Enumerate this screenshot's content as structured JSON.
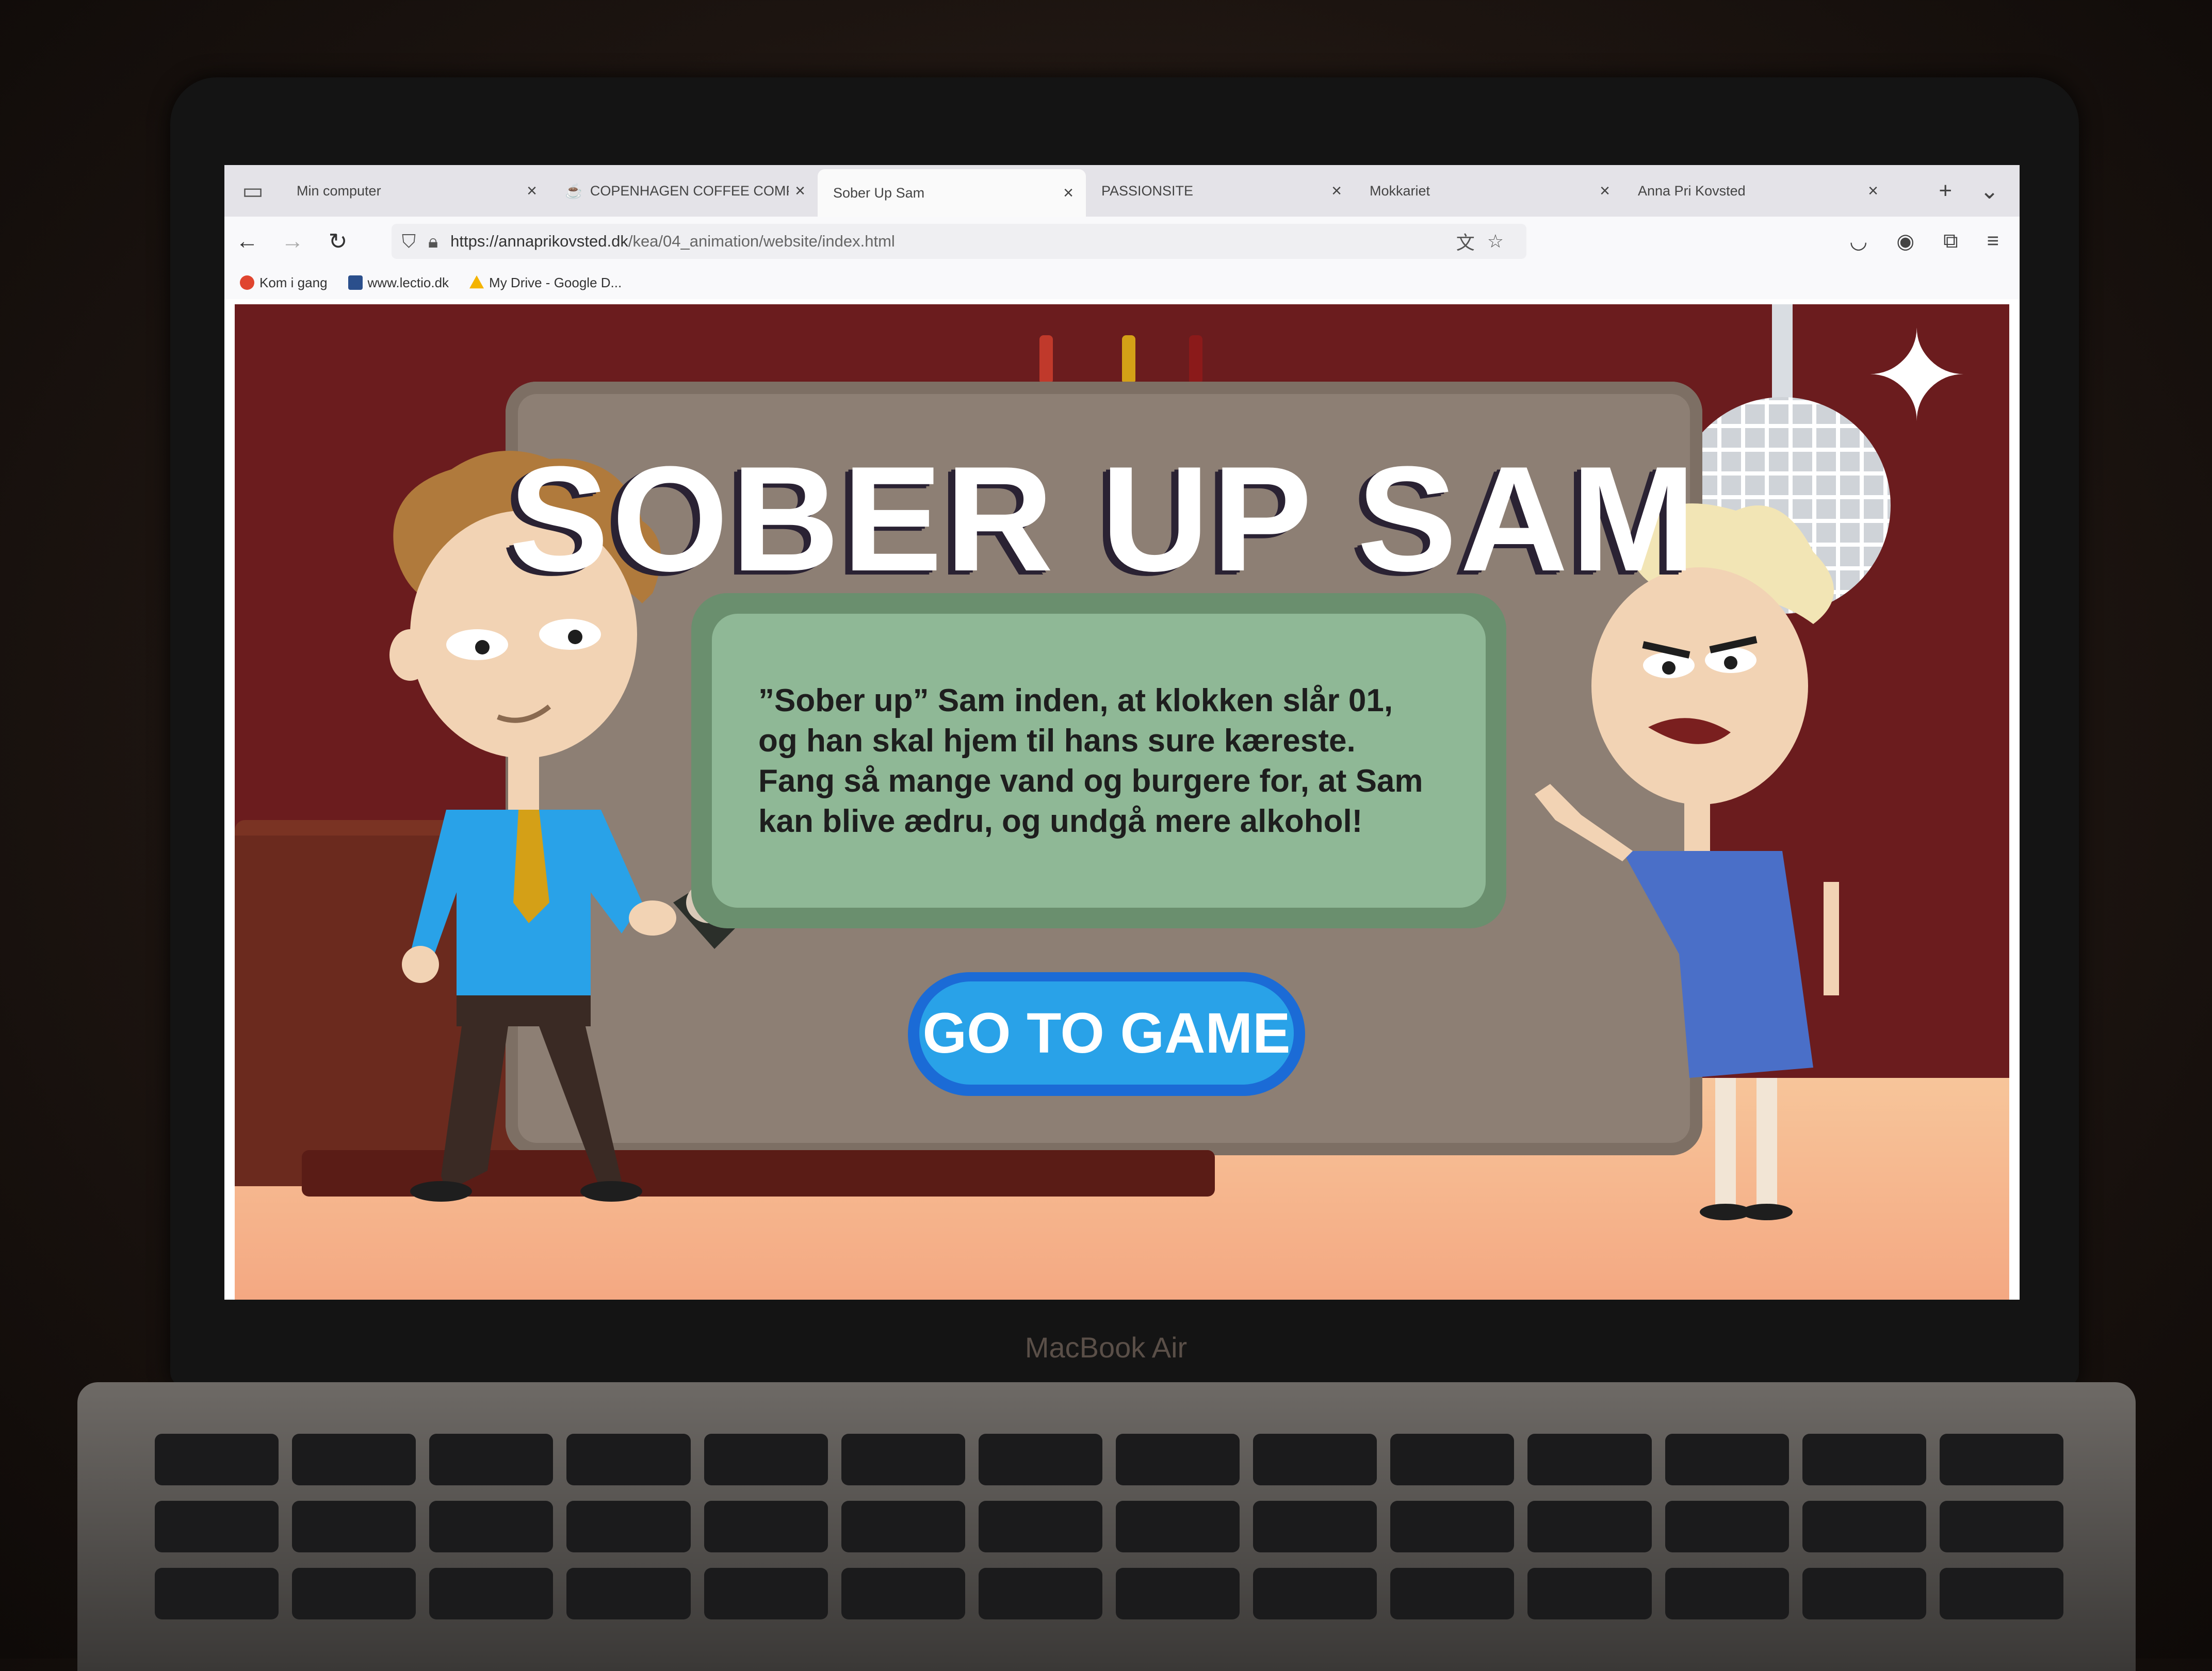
{
  "browser": {
    "tabs": [
      {
        "label": "Min computer",
        "active": false
      },
      {
        "label": "COPENHAGEN COFFEE COMPANY",
        "active": false
      },
      {
        "label": "Sober Up Sam",
        "active": true
      },
      {
        "label": "PASSIONSITE",
        "active": false
      },
      {
        "label": "Mokkariet",
        "active": false
      },
      {
        "label": "Anna Pri Kovsted",
        "active": false
      }
    ],
    "url_host": "https://annaprikovsted.dk",
    "url_path": "/kea/04_animation/website/index.html",
    "bookmarks": [
      {
        "label": "Kom i gang",
        "color": "#e0452f"
      },
      {
        "label": "www.lectio.dk",
        "color": "#2b4f8c"
      },
      {
        "label": "My Drive - Google D...",
        "color": "#f4b400"
      }
    ]
  },
  "game": {
    "title": "SOBER UP SAM",
    "description": "”Sober up” Sam inden, at klokken slår 01, og han skal hjem til hans sure kæreste. Fang så mange vand og burgere for, at Sam kan blive ædru, og undgå mere alkohol!",
    "button_label": "GO TO GAME"
  },
  "device": {
    "brand_label": "MacBook Air"
  },
  "icons": [
    "sidebar-icon",
    "close-icon",
    "new-tab-icon",
    "tab-list-icon",
    "back-icon",
    "forward-icon",
    "reload-icon",
    "shield-icon",
    "lock-icon",
    "translate-icon",
    "star-icon",
    "pocket-icon",
    "account-icon",
    "extensions-icon",
    "menu-icon"
  ],
  "colors": {
    "background": "#6b1c1e",
    "button": "#29a2e8",
    "panel": "#8fb896",
    "board": "#8d7f74"
  }
}
